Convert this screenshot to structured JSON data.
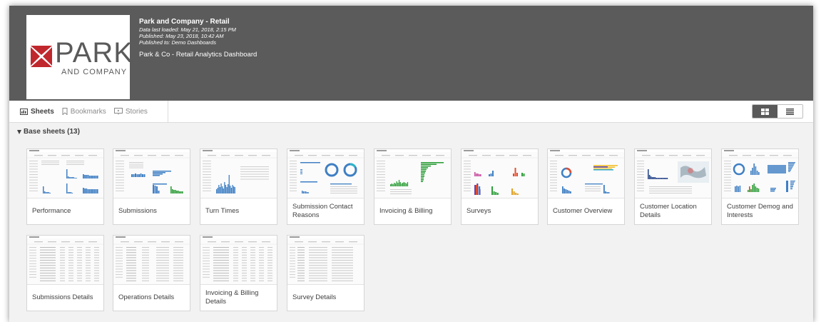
{
  "app": {
    "title": "Park and Company - Retail",
    "last_loaded": "Data last loaded: May 21, 2018, 2:15 PM",
    "published": "Published: May 23, 2018, 10:42 AM",
    "published_to": "Published to: Demo Dashboards",
    "description": "Park & Co - Retail Analytics Dashboard",
    "logo": {
      "word": "PARK",
      "sub": "AND COMPANY",
      "mark_color": "#c0272d"
    }
  },
  "tabs": [
    {
      "label": "Sheets",
      "icon": "sheets-icon",
      "active": true
    },
    {
      "label": "Bookmarks",
      "icon": "bookmark-icon",
      "active": false
    },
    {
      "label": "Stories",
      "icon": "stories-icon",
      "active": false
    }
  ],
  "view_toggle": {
    "grid_icon": "grid-view-icon",
    "list_icon": "list-view-icon",
    "active": "grid"
  },
  "section": {
    "title": "Base sheets (13)"
  },
  "sheets": [
    {
      "label": "Performance",
      "thumb": "perf"
    },
    {
      "label": "Submissions",
      "thumb": "subm"
    },
    {
      "label": "Turn Times",
      "thumb": "turn"
    },
    {
      "label": "Submission Contact Reasons",
      "thumb": "donut2"
    },
    {
      "label": "Invoicing & Billing",
      "thumb": "green"
    },
    {
      "label": "Surveys",
      "thumb": "surveys"
    },
    {
      "label": "Customer Overview",
      "thumb": "custov"
    },
    {
      "label": "Customer Location Details",
      "thumb": "map"
    },
    {
      "label": "Customer Demog and Interests",
      "thumb": "demog"
    },
    {
      "label": "Submissions Details",
      "thumb": "table"
    },
    {
      "label": "Operations Details",
      "thumb": "table2"
    },
    {
      "label": "Invoicing & Billing Details",
      "thumb": "table"
    },
    {
      "label": "Survey Details",
      "thumb": "table3"
    }
  ],
  "colors": {
    "header_bg": "#5b5b5b",
    "accent_blue": "#3f7fc4",
    "accent_green": "#2e9e3a",
    "toggle_active": "#595959"
  }
}
